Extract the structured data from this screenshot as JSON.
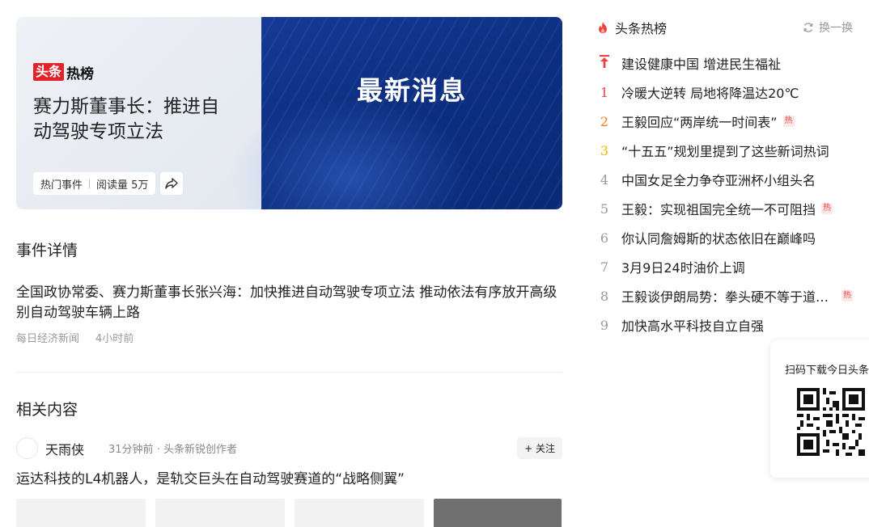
{
  "banner": {
    "logo_part1": "头条",
    "logo_part2": "热榜",
    "title": "赛力斯董事长：推进自动驾驶专项立法",
    "meta_category": "热门事件",
    "meta_reads": "阅读量 5万",
    "headline_image_text": "最新消息"
  },
  "event": {
    "section_title": "事件详情",
    "text": "全国政协常委、赛力斯董事长张兴海：加快推进自动驾驶专项立法 推动依法有序放开高级别自动驾驶车辆上路",
    "source": "每日经济新闻",
    "time": "4小时前"
  },
  "related": {
    "section_title": "相关内容",
    "author": "天雨侠",
    "author_meta": "31分钟前 · 头条新锐创作者",
    "follow_label": "+ 关注",
    "title": "运达科技的L4机器人，是轨交巨头在自动驾驶赛道的“战略侧翼”"
  },
  "hot": {
    "title": "头条热榜",
    "refresh_label": "换一换",
    "items": [
      {
        "rank": "",
        "text": "建设健康中国 增进民生福祉",
        "badge": ""
      },
      {
        "rank": "1",
        "text": "冷暖大逆转 局地将降温达20℃",
        "badge": ""
      },
      {
        "rank": "2",
        "text": "王毅回应“两岸统一时间表”",
        "badge": "热"
      },
      {
        "rank": "3",
        "text": "“十五五”规划里提到了这些新词热词",
        "badge": ""
      },
      {
        "rank": "4",
        "text": "中国女足全力争夺亚洲杯小组头名",
        "badge": ""
      },
      {
        "rank": "5",
        "text": "王毅：实现祖国完全统一不可阻挡",
        "badge": "热"
      },
      {
        "rank": "6",
        "text": "你认同詹姆斯的状态依旧在巅峰吗",
        "badge": ""
      },
      {
        "rank": "7",
        "text": "3月9日24时油价上调",
        "badge": ""
      },
      {
        "rank": "8",
        "text": "王毅谈伊朗局势：拳头硬不等于道理硬",
        "badge": "热"
      },
      {
        "rank": "9",
        "text": "加快高水平科技自立自强",
        "badge": ""
      }
    ]
  },
  "qr": {
    "text": "扫码下载今日头条"
  },
  "colors": {
    "accent_red": "#f04142",
    "rank2": "#ff7a1a",
    "rank3": "#f5b800",
    "banner_blue": "#0d2f82"
  }
}
